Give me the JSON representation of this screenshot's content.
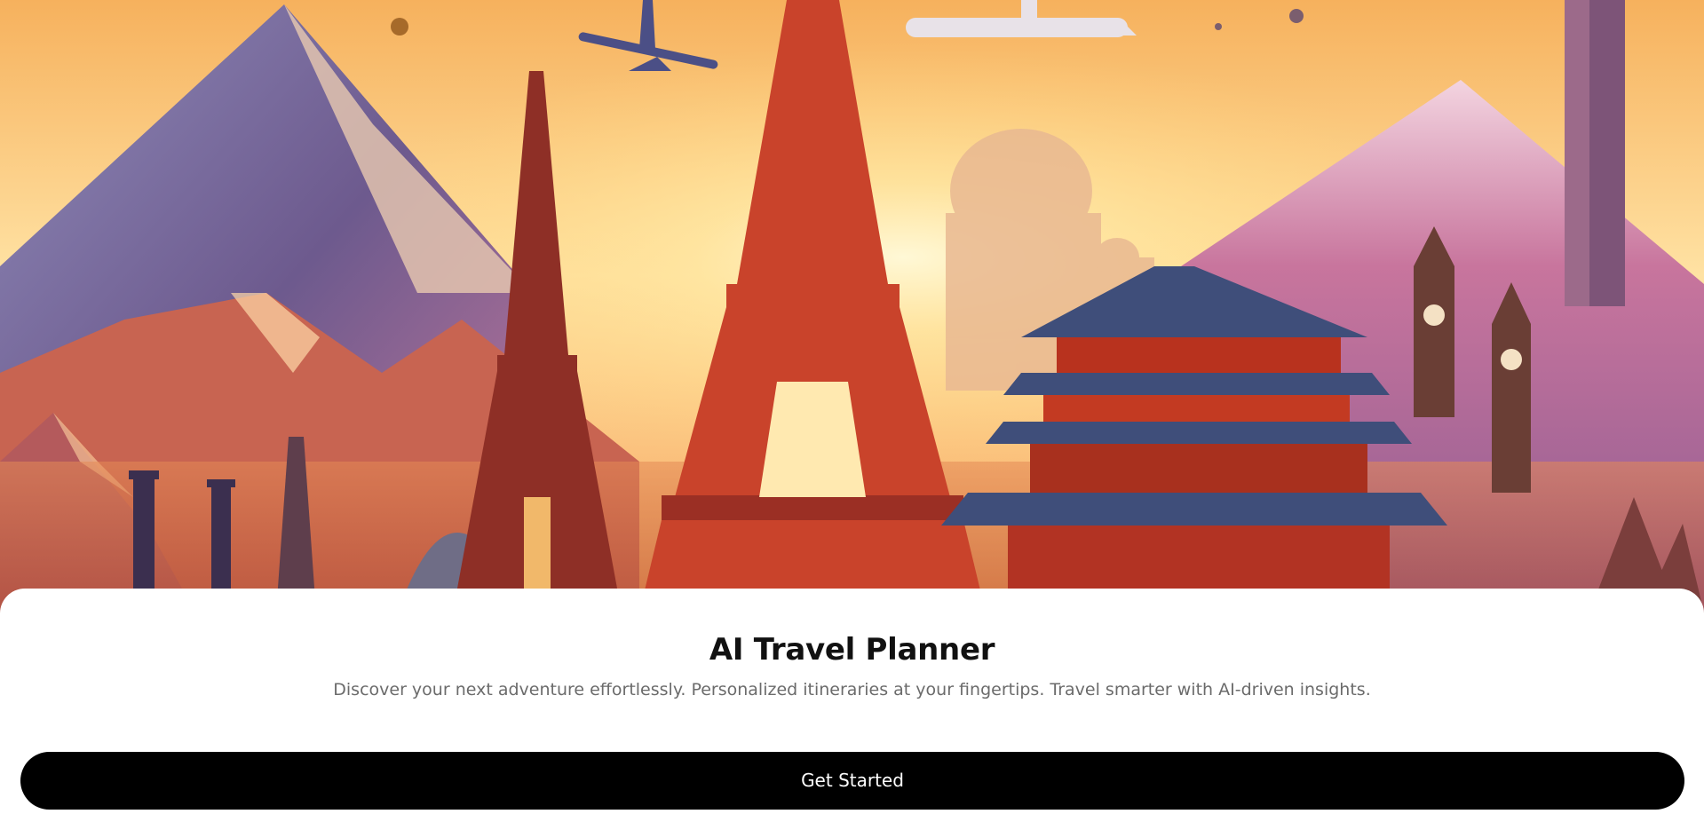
{
  "hero": {
    "image": "travel-landmarks-illustration",
    "colors": {
      "sky_top": "#F7C46D",
      "sky_mid": "#FFE7A6",
      "mountain_purple": "#6E5A92",
      "mountain_pink": "#C86A8E",
      "tower_red": "#C84A2A",
      "pagoda_red": "#B8321E",
      "pagoda_roof": "#3F4E7A"
    }
  },
  "main": {
    "title": "AI Travel Planner",
    "subtitle": "Discover your next adventure effortlessly. Personalized itineraries at your fingertips. Travel smarter with AI-driven insights.",
    "cta_label": "Get Started"
  },
  "colors": {
    "background": "#FFFFFF",
    "title": "#111111",
    "subtitle": "#6B6B6B",
    "button_bg": "#000000",
    "button_text": "#FFFFFF"
  }
}
